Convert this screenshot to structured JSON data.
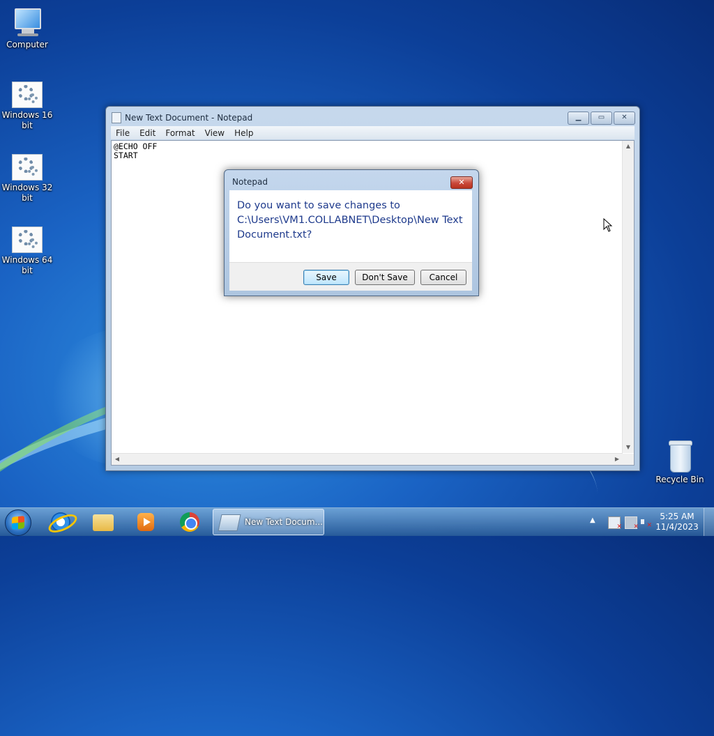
{
  "desktop": {
    "icons": [
      {
        "label": "Computer",
        "icon": "computer-icon"
      },
      {
        "label": "Windows 16 bit",
        "icon": "batch-file-icon"
      },
      {
        "label": "Windows 32 bit",
        "icon": "batch-file-icon"
      },
      {
        "label": "Windows 64 bit",
        "icon": "batch-file-icon"
      },
      {
        "label": "Recycle Bin",
        "icon": "recycle-bin-icon"
      }
    ]
  },
  "notepad": {
    "title": "New Text Document - Notepad",
    "menu": [
      "File",
      "Edit",
      "Format",
      "View",
      "Help"
    ],
    "content": "@ECHO OFF\nSTART"
  },
  "dialog": {
    "title": "Notepad",
    "message": "Do you want to save changes to C:\\Users\\VM1.COLLABNET\\Desktop\\New Text Document.txt?",
    "buttons": {
      "save": "Save",
      "dont_save": "Don't Save",
      "cancel": "Cancel"
    },
    "close_glyph": "✕"
  },
  "taskbar": {
    "pinned": [
      {
        "name": "Internet Explorer",
        "icon": "internet-explorer-icon"
      },
      {
        "name": "Windows Explorer",
        "icon": "folder-icon"
      },
      {
        "name": "Windows Media Player",
        "icon": "media-player-icon"
      },
      {
        "name": "Google Chrome",
        "icon": "chrome-icon"
      }
    ],
    "active_task": "New Text Docum...",
    "clock": {
      "time": "5:25 AM",
      "date": "11/4/2023"
    }
  },
  "colors": {
    "dialog_message": "#1e3a8c",
    "desktop_bg": "#1a63c4"
  }
}
